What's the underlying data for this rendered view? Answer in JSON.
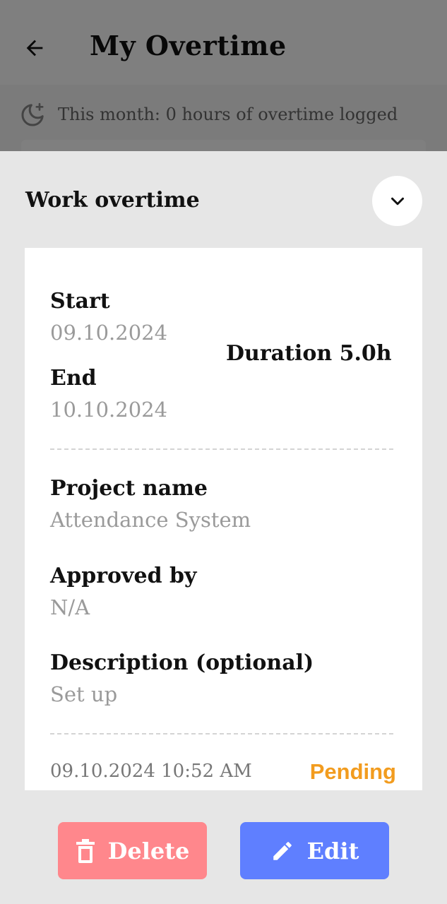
{
  "appbar": {
    "title": "My Overtime",
    "back_icon": "arrow-left-icon"
  },
  "banner": {
    "icon": "moon-icon",
    "text": "This month: 0 hours of overtime logged"
  },
  "sheet": {
    "title": "Work overtime",
    "collapse_icon": "chevron-down-icon",
    "entry": {
      "start_label": "Start",
      "start_value": "09.10.2024",
      "end_label": "End",
      "end_value": "10.10.2024",
      "duration": "Duration 5.0h",
      "project_label": "Project name",
      "project_value": "Attendance System",
      "approved_label": "Approved by",
      "approved_value": "N/A",
      "description_label": "Description (optional)",
      "description_value": "Set up",
      "timestamp": "09.10.2024 10:52 AM",
      "status": "Pending",
      "status_color": "#f29c1f"
    },
    "actions": {
      "delete_label": "Delete",
      "delete_icon": "trash-icon",
      "delete_color": "#ff878c",
      "edit_label": "Edit",
      "edit_icon": "pencil-icon",
      "edit_color": "#5f7fff"
    }
  }
}
